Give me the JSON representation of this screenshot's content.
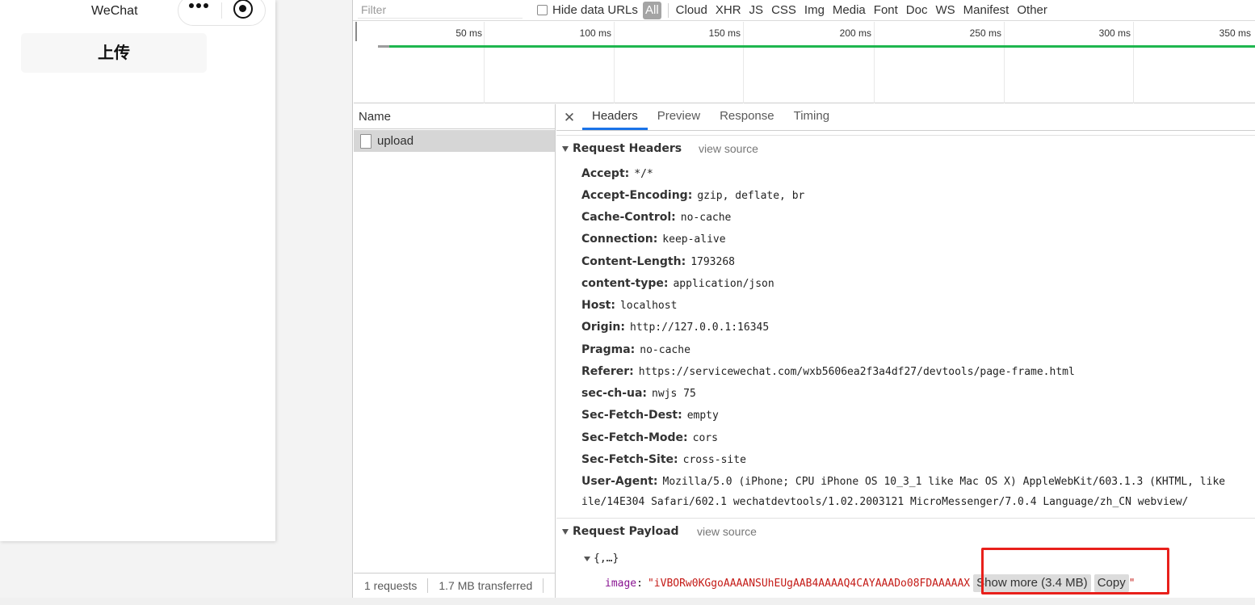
{
  "simulator": {
    "title": "WeChat",
    "upload_button": "上传"
  },
  "toolbar": {
    "filter_placeholder": "Filter",
    "hide_data_urls": "Hide data URLs",
    "type_filters": [
      "All",
      "Cloud",
      "XHR",
      "JS",
      "CSS",
      "Img",
      "Media",
      "Font",
      "Doc",
      "WS",
      "Manifest",
      "Other"
    ],
    "active_filter": "All"
  },
  "timeline": {
    "ticks": [
      "50 ms",
      "100 ms",
      "150 ms",
      "200 ms",
      "250 ms",
      "300 ms",
      "350 ms"
    ]
  },
  "requests": {
    "column_header": "Name",
    "items": [
      {
        "name": "upload"
      }
    ],
    "status": {
      "count": "1 requests",
      "transferred": "1.7 MB transferred"
    }
  },
  "details": {
    "tabs": [
      "Headers",
      "Preview",
      "Response",
      "Timing"
    ],
    "active_tab": "Headers",
    "request_headers": {
      "title": "Request Headers",
      "view_source": "view source",
      "rows": [
        {
          "name": "Accept:",
          "value": "*/*"
        },
        {
          "name": "Accept-Encoding:",
          "value": "gzip, deflate, br"
        },
        {
          "name": "Cache-Control:",
          "value": "no-cache"
        },
        {
          "name": "Connection:",
          "value": "keep-alive"
        },
        {
          "name": "Content-Length:",
          "value": "1793268"
        },
        {
          "name": "content-type:",
          "value": "application/json"
        },
        {
          "name": "Host:",
          "value": "localhost"
        },
        {
          "name": "Origin:",
          "value": "http://127.0.0.1:16345"
        },
        {
          "name": "Pragma:",
          "value": "no-cache"
        },
        {
          "name": "Referer:",
          "value": "https://servicewechat.com/wxb5606ea2f3a4df27/devtools/page-frame.html"
        },
        {
          "name": "sec-ch-ua:",
          "value": "nwjs 75"
        },
        {
          "name": "Sec-Fetch-Dest:",
          "value": "empty"
        },
        {
          "name": "Sec-Fetch-Mode:",
          "value": "cors"
        },
        {
          "name": "Sec-Fetch-Site:",
          "value": "cross-site"
        },
        {
          "name": "User-Agent:",
          "value": "Mozilla/5.0 (iPhone; CPU iPhone OS 10_3_1 like Mac OS X) AppleWebKit/603.1.3 (KHTML, like"
        }
      ],
      "user_agent_continued": "ile/14E304 Safari/602.1 wechatdevtools/1.02.2003121 MicroMessenger/7.0.4 Language/zh_CN webview/"
    },
    "request_payload": {
      "title": "Request Payload",
      "view_source": "view source",
      "root": "{,…}",
      "key": "image",
      "value": "\"iVBORw0KGgoAAAANSUhEUgAAB4AAAAQ4CAYAAADo08FDAAAAAX",
      "show_more": "Show more (3.4 MB)",
      "copy": "Copy",
      "trailing": "\""
    }
  },
  "colors": {
    "timeline_bar": "#1fb64f",
    "active_tab_underline": "#1a73e8",
    "highlight_box": "#e8201b",
    "payload_key": "#881391",
    "payload_string": "#c41a16"
  }
}
